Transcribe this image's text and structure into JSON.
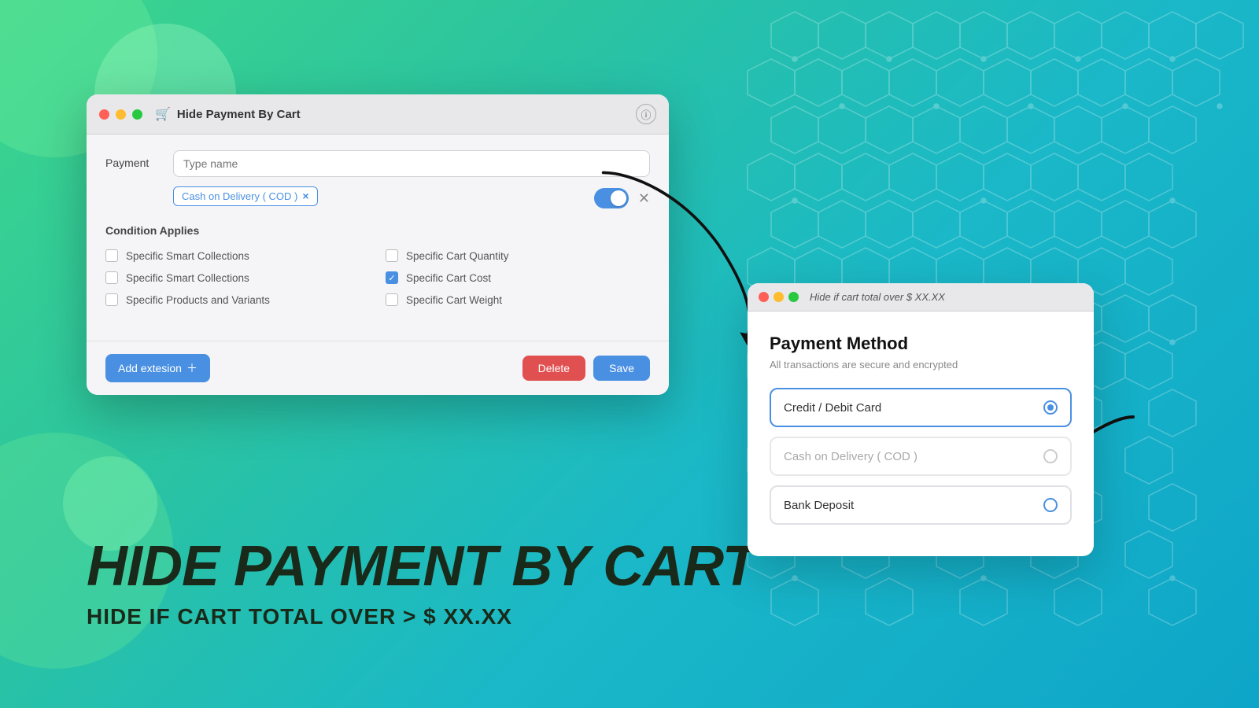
{
  "background": {
    "gradient_start": "#3dd68c",
    "gradient_end": "#0ea5c8"
  },
  "admin_window": {
    "title": "Hide Payment By Cart",
    "traffic_lights": [
      "red",
      "yellow",
      "green"
    ],
    "info_icon": "ⓘ",
    "payment": {
      "label": "Payment",
      "input_placeholder": "Type name",
      "tag": "Cash on Delivery ( COD )",
      "tag_close": "×",
      "toggle_on": true,
      "close_x": "✕"
    },
    "condition_applies": {
      "title": "Condition Applies",
      "items": [
        {
          "label": "Specific Smart Collections",
          "checked": false,
          "col": 1
        },
        {
          "label": "Specific Cart Quantity",
          "checked": false,
          "col": 2
        },
        {
          "label": "Specific Smart Collections",
          "checked": false,
          "col": 1
        },
        {
          "label": "Specific Cart Cost",
          "checked": true,
          "col": 2
        },
        {
          "label": "Specific Products and Variants",
          "checked": false,
          "col": 1
        },
        {
          "label": "Specific Cart Weight",
          "checked": false,
          "col": 2
        }
      ]
    },
    "footer": {
      "add_button": "Add extesion",
      "delete_button": "Delete",
      "save_button": "Save"
    }
  },
  "hero_text": {
    "title": "HIDE PAYMENT BY CART",
    "subtitle": "HIDE IF CART TOTAL OVER > $ XX.XX"
  },
  "payment_window": {
    "traffic_lights": [
      "red",
      "yellow",
      "green"
    ],
    "title_label": "Hide if cart total over $ XX.XX",
    "method_title": "Payment Method",
    "method_subtitle": "All transactions are secure and encrypted",
    "options": [
      {
        "label": "Credit / Debit Card",
        "active": true,
        "grayed": false
      },
      {
        "label": "Cash on Delivery ( COD )",
        "active": false,
        "grayed": true
      },
      {
        "label": "Bank Deposit",
        "active": false,
        "grayed": false
      }
    ]
  }
}
